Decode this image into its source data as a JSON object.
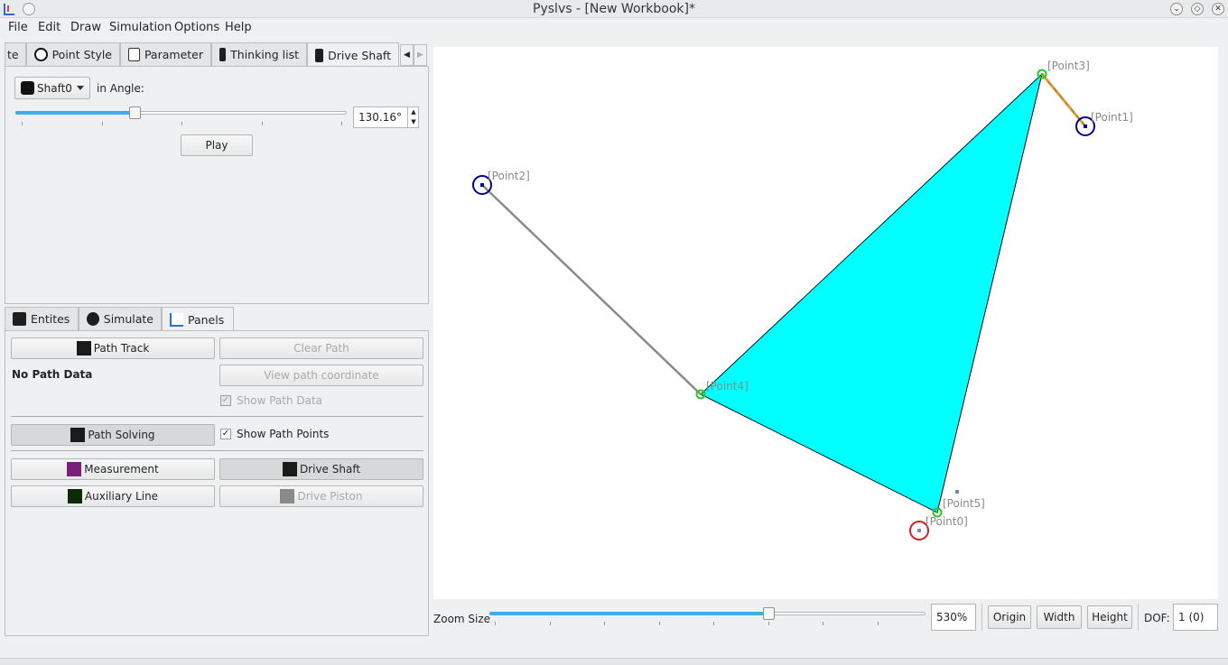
{
  "window": {
    "title": "Pyslvs - [New Workbook]*"
  },
  "menu": [
    "File",
    "Edit",
    "Draw",
    "Simulation",
    "Options",
    "Help"
  ],
  "top_tabs": {
    "items": [
      "te",
      "Point Style",
      "Parameter",
      "Thinking list",
      "Drive Shaft"
    ],
    "active": "Drive Shaft"
  },
  "drive_shaft": {
    "shaft_select": "Shaft0",
    "angle_label": "in Angle:",
    "angle_value": "130.16°",
    "angle_fraction": 0.36,
    "play_label": "Play"
  },
  "bottom_tabs": {
    "items": [
      "Entites",
      "Simulate",
      "Panels"
    ],
    "active": "Panels"
  },
  "panels": {
    "path_track": "Path Track",
    "clear_path": "Clear Path",
    "no_path_data": "No Path Data",
    "view_path_coordinate": "View path coordinate",
    "show_path_data": "Show Path Data",
    "path_solving": "Path Solving",
    "show_path_points": "Show Path Points",
    "measurement": "Measurement",
    "drive_shaft": "Drive Shaft",
    "auxiliary_line": "Auxiliary Line",
    "drive_piston": "Drive Piston"
  },
  "canvas": {
    "points": [
      "[Point0]",
      "[Point1]",
      "[Point2]",
      "[Point3]",
      "[Point4]",
      "[Point5]"
    ],
    "colors": {
      "fill": "#00ffff",
      "ground": "#00008b",
      "joint": "#28c828",
      "driver": "#cc2020",
      "link": "#808080",
      "shaft": "#e0a020"
    }
  },
  "statusbar": {
    "zoom_label": "Zoom Size",
    "zoom_value": "530%",
    "zoom_fraction": 0.64,
    "origin": "Origin",
    "width": "Width",
    "height": "Height",
    "dof_label": "DOF:",
    "dof_value": "1 (0)"
  }
}
